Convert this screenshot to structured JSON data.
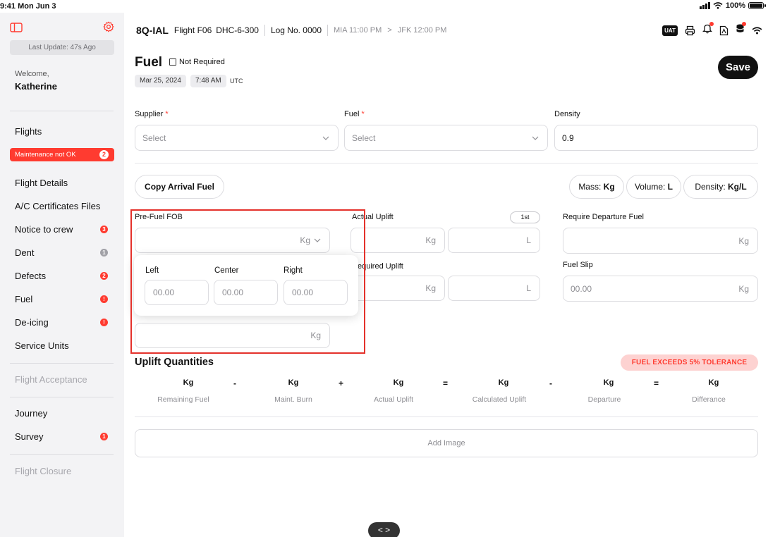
{
  "status_bar": {
    "time": "9:41 Mon Jun 3",
    "battery": "100%"
  },
  "sidebar": {
    "last_update": "Last Update: 47s Ago",
    "welcome": "Welcome,",
    "user": "Katherine",
    "flights": "Flights",
    "maintenance": {
      "label": "Maintenance not OK",
      "count": "2"
    },
    "items": [
      {
        "label": "Flight Details"
      },
      {
        "label": "A/C Certificates Files"
      },
      {
        "label": "Notice to crew",
        "badge": "3"
      },
      {
        "label": "Dent",
        "badge": "1"
      },
      {
        "label": "Defects",
        "badge": "2"
      },
      {
        "label": "Fuel",
        "badge": "!"
      },
      {
        "label": "De-icing",
        "badge": "!"
      },
      {
        "label": "Service Units"
      }
    ],
    "flight_acceptance": "Flight Acceptance",
    "journey": "Journey",
    "survey": {
      "label": "Survey",
      "badge": "1"
    },
    "flight_closure": "Flight Closure"
  },
  "header": {
    "registration": "8Q-IAL",
    "flight": "Flight F06",
    "aircraft": "DHC-6-300",
    "log": "Log No. 0000",
    "from": "MIA 11:00 PM",
    "arrow": ">",
    "to": "JFK 12:00 PM",
    "uat": "UAT"
  },
  "page": {
    "title": "Fuel",
    "not_required": "Not Required",
    "date": "Mar 25, 2024",
    "time": "7:48 AM",
    "tz": "UTC",
    "save": "Save"
  },
  "form": {
    "supplier": {
      "label": "Supplier",
      "placeholder": "Select"
    },
    "fuel": {
      "label": "Fuel",
      "placeholder": "Select"
    },
    "density": {
      "label": "Density",
      "value": "0.9"
    },
    "required_mark": "*",
    "copy_arrival": "Copy Arrival Fuel",
    "units": {
      "mass_label": "Mass:",
      "mass_value": "Kg",
      "volume_label": "Volume:",
      "volume_value": "L",
      "density_label": "Density:",
      "density_value": "Kg/L"
    },
    "pre_fuel_fob": {
      "label": "Pre-Fuel FOB",
      "unit": "Kg"
    },
    "actual_uplift": {
      "label": "Actual Uplift",
      "unit_mass": "Kg",
      "unit_vol": "L",
      "chip": "1st"
    },
    "required_uplift": {
      "label": "Required Uplift",
      "label_visible": "equired Uplift",
      "unit_mass": "Kg",
      "unit_vol": "L"
    },
    "require_departure": {
      "label": "Require Departure Fuel",
      "unit": "Kg"
    },
    "fuel_slip": {
      "label": "Fuel Slip",
      "placeholder": "00.00",
      "unit": "Kg"
    },
    "extra_field": {
      "unit": "Kg"
    },
    "popover": {
      "left": "Left",
      "center": "Center",
      "right": "Right",
      "placeholder": "00.00"
    }
  },
  "uplift": {
    "title": "Uplift  Quantities",
    "tolerance": "FUEL EXCEEDS 5% TOLERANCE",
    "columns": [
      {
        "value": "Kg",
        "label": "Remaining Fuel"
      },
      {
        "value": "Kg",
        "label": "Maint. Burn"
      },
      {
        "value": "Kg",
        "label": "Actual Uplift"
      },
      {
        "value": "Kg",
        "label": "Calculated Uplift"
      },
      {
        "value": "Kg",
        "label": "Departure"
      },
      {
        "value": "Kg",
        "label": "Differance"
      }
    ],
    "operators": [
      "-",
      "+",
      "=",
      "-",
      "="
    ]
  },
  "add_image": "Add Image",
  "bottom_nav": "< >"
}
